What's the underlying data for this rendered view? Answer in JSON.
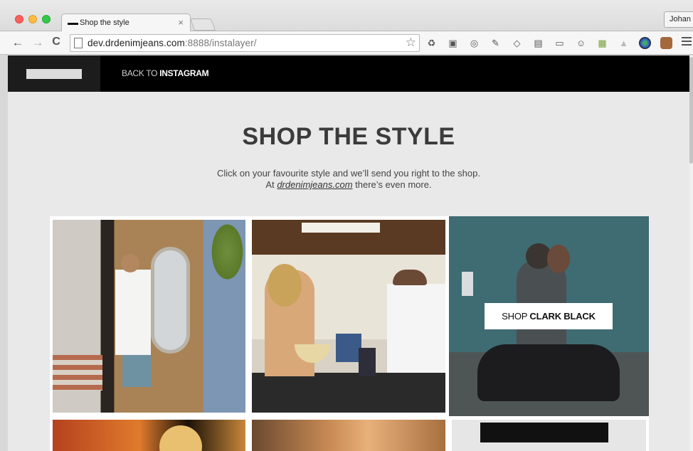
{
  "browser": {
    "tab_title": "Shop the style",
    "tab_close": "×",
    "user_button": "Johan",
    "url_host": "dev.drdenimjeans.com",
    "url_rest": ":8888/instalayer/",
    "nav": {
      "back": "←",
      "forward": "→",
      "reload": "C"
    },
    "star": "☆"
  },
  "site": {
    "back_prefix": "BACK TO",
    "back_strong": "INSTAGRAM",
    "title": "SHOP THE STYLE",
    "subtitle_line1": "Click on your favourite style and we’ll send you right to the shop.",
    "subtitle_at": "At",
    "subtitle_link": "drdenimjeans.com",
    "subtitle_end": "there’s even more.",
    "shop_prefix": "SHOP",
    "shop_product": "CLARK BLACK"
  },
  "colors": {
    "nav_bg": "#000000",
    "page_bg": "#e9e9e9",
    "title": "#3b3b3b"
  }
}
